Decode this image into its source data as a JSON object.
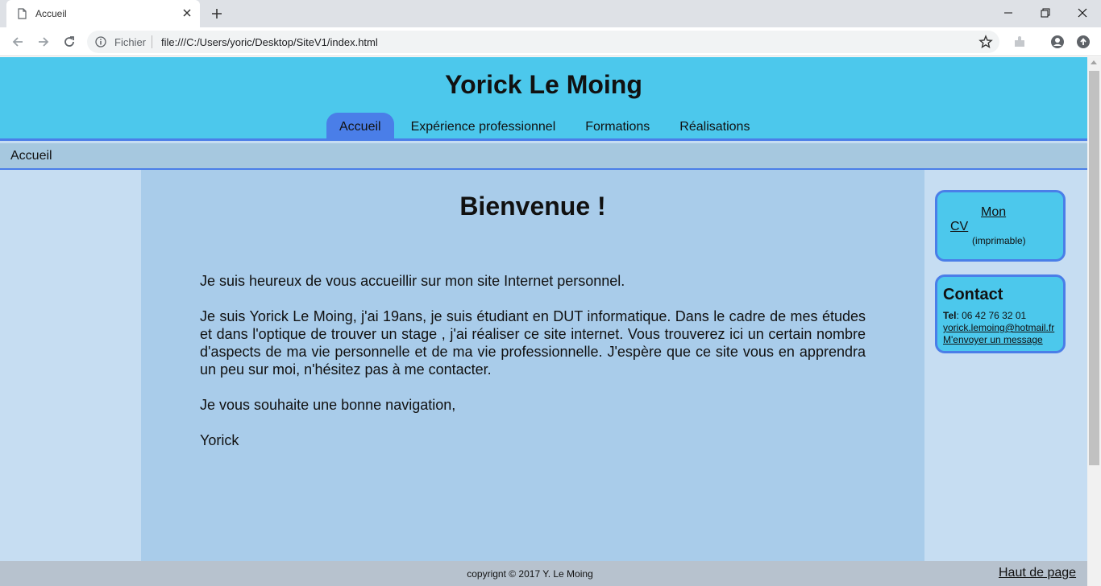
{
  "browser": {
    "tab_title": "Accueil",
    "address_scheme": "Fichier",
    "address_url": "file:///C:/Users/yoric/Desktop/SiteV1/index.html"
  },
  "site": {
    "title": "Yorick Le Moing",
    "nav": [
      {
        "label": "Accueil",
        "active": true
      },
      {
        "label": "Expérience professionnel",
        "active": false
      },
      {
        "label": "Formations",
        "active": false
      },
      {
        "label": "Réalisations",
        "active": false
      }
    ],
    "breadcrumb": "Accueil"
  },
  "main": {
    "heading": "Bienvenue !",
    "paragraphs": [
      "Je suis heureux de vous accueillir sur mon site Internet personnel.",
      "Je suis Yorick Le Moing, j'ai 19ans, je suis étudiant en DUT informatique. Dans le cadre de mes études et dans l'optique de trouver un stage , j'ai réaliser ce site internet. Vous trouverez ici un certain nombre d'aspects de ma vie personnelle et de ma vie professionnelle. J'espère que ce site vous en apprendra un peu sur moi, n'hésitez pas à me contacter.",
      "Je vous souhaite une bonne navigation,",
      "Yorick"
    ]
  },
  "aside": {
    "cv_link_part1": "Mon",
    "cv_link_part2": "CV",
    "cv_note": "(imprimable)",
    "contact_title": "Contact",
    "tel_label": "Tel",
    "tel_value": ": 06 42 76 32 01",
    "email": "yorick.lemoing@hotmail.fr",
    "message_link": "M'envoyer un message"
  },
  "footer": {
    "copyright": "copyrignt © 2017 Y. Le Moing",
    "top_link": "Haut de page"
  },
  "colors": {
    "header_bg": "#4cc8ec",
    "accent": "#4a7ee8",
    "main_bg": "#a9ccea",
    "side_bg": "#c6ddf2"
  }
}
